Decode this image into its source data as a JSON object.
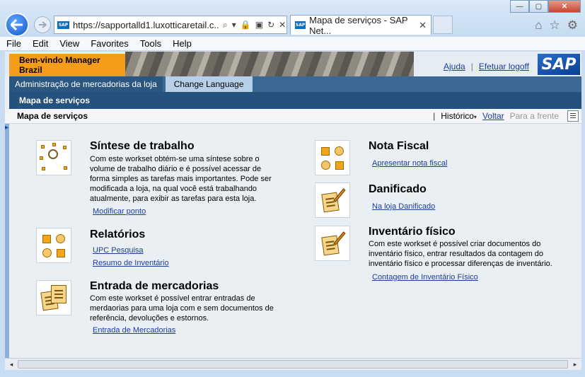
{
  "browser": {
    "url": "https://sapportalld1.luxotticaretail.c...",
    "tab_title": "Mapa de serviços - SAP Net...",
    "tab_close": "✕",
    "favicon_text": "SAP",
    "menu": [
      "File",
      "Edit",
      "View",
      "Favorites",
      "Tools",
      "Help"
    ],
    "window_buttons": {
      "minimize": "—",
      "maximize": "▢",
      "close": "✕"
    },
    "toolbar_icons": {
      "home": "⌂",
      "favorites": "☆",
      "tools": "⚙"
    },
    "address_icons": [
      "⌕",
      "▾",
      "🔒",
      "▣",
      "↻",
      "✕"
    ]
  },
  "header": {
    "welcome": "Bem-vindo Manager Brazil",
    "help_link": "Ajuda",
    "separator": "|",
    "logoff_link": "Efetuar logoff",
    "logo_text": "SAP"
  },
  "nav": {
    "level1_selected": "Administração de mercadorias da loja",
    "change_language": "Change Language",
    "level2": "Mapa de serviços"
  },
  "titlebar": {
    "title": "Mapa de serviços",
    "separator": "|",
    "history": "Histórico",
    "back": "Voltar",
    "forward": "Para a frente"
  },
  "worksets": {
    "sintese": {
      "title": "Síntese de trabalho",
      "desc": "Com este workset obtém-se uma síntese sobre o volume de trabalho diário e é possível acessar de forma simples as tarefas mais importantes. Pode ser modificada a loja, na qual você está trabalhando atualmente, para exibir as tarefas para esta loja.",
      "links": [
        "Modificar ponto"
      ]
    },
    "relatorios": {
      "title": "Relatórios",
      "links": [
        "UPC Pesquisa",
        "Resumo de Inventário"
      ]
    },
    "entrada": {
      "title": "Entrada de mercadorias",
      "desc": "Com este workset é possível entrar entradas de merdaorias para uma loja com e sem documentos de referência, devoluções e estornos.",
      "links": [
        "Entrada de Mercadorias"
      ]
    },
    "nota": {
      "title": "Nota Fiscal",
      "links": [
        "Apresentar nota fiscal"
      ]
    },
    "danificado": {
      "title": "Danificado",
      "links": [
        "Na loja Danificado"
      ]
    },
    "inventario": {
      "title": "Inventário físico",
      "desc": "Com este workset é possível criar documentos do inventário físico, entrar resultados da contagem do inventário físico e processar diferenças de inventário.",
      "links": [
        "Contagem de Inventário Físico"
      ]
    }
  },
  "colors": {
    "welcome_bg": "#f59c1a",
    "nav_bar": "#3c6993",
    "nav_sub": "#24527d",
    "link": "#1a3e9e",
    "content_bg": "#eaeff4"
  }
}
